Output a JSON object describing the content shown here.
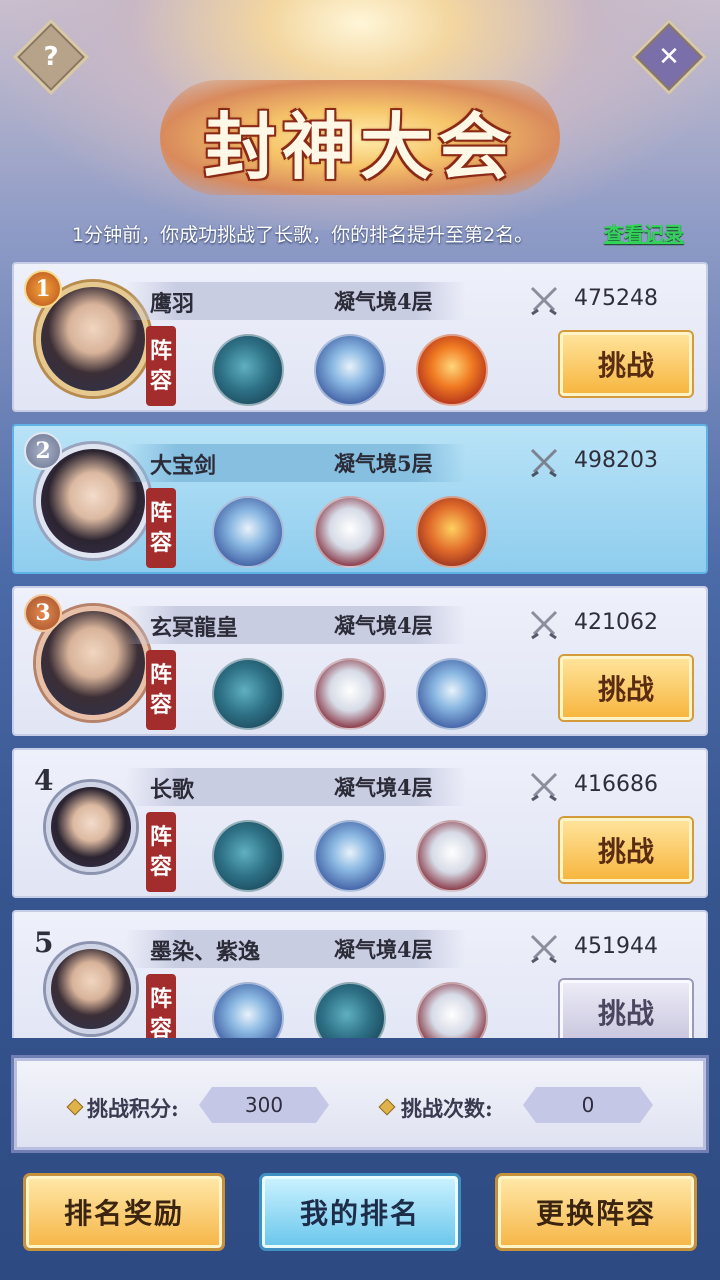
{
  "header": {
    "title": "封神大会",
    "help_icon": "?",
    "close_icon": "✕"
  },
  "notice": {
    "text": "1分钟前，你成功挑战了长歌，你的排名提升至第2名。",
    "record_link": "查看记录"
  },
  "lineup_label": [
    "阵",
    "容"
  ],
  "challenge_label": "挑战",
  "players": [
    {
      "rank": "1",
      "name": "鹰羽",
      "realm": "凝气境4层",
      "power": "475248",
      "beasts": [
        "whale",
        "dragon",
        "phoenix"
      ],
      "can_challenge": true
    },
    {
      "rank": "2",
      "name": "大宝剑",
      "realm": "凝气境5层",
      "power": "498203",
      "beasts": [
        "dragon",
        "tiger",
        "reddragon"
      ],
      "self": true
    },
    {
      "rank": "3",
      "name": "玄冥龍皇",
      "realm": "凝气境4层",
      "power": "421062",
      "beasts": [
        "whale",
        "tiger",
        "dragon"
      ],
      "can_challenge": true
    },
    {
      "rank": "4",
      "name": "长歌",
      "realm": "凝气境4层",
      "power": "416686",
      "beasts": [
        "whale",
        "dragon",
        "tiger"
      ],
      "can_challenge": true
    },
    {
      "rank": "5",
      "name": "墨染、紫逸",
      "realm": "凝气境4层",
      "power": "451944",
      "beasts": [
        "dragon",
        "whale",
        "tiger"
      ],
      "can_challenge": false
    }
  ],
  "score": {
    "points_label": "挑战积分:",
    "points_value": "300",
    "count_label": "挑战次数:",
    "count_value": "0"
  },
  "bottom": {
    "reward_label": "排名奖励",
    "my_rank_label": "我的排名",
    "change_lineup_label": "更换阵容"
  }
}
